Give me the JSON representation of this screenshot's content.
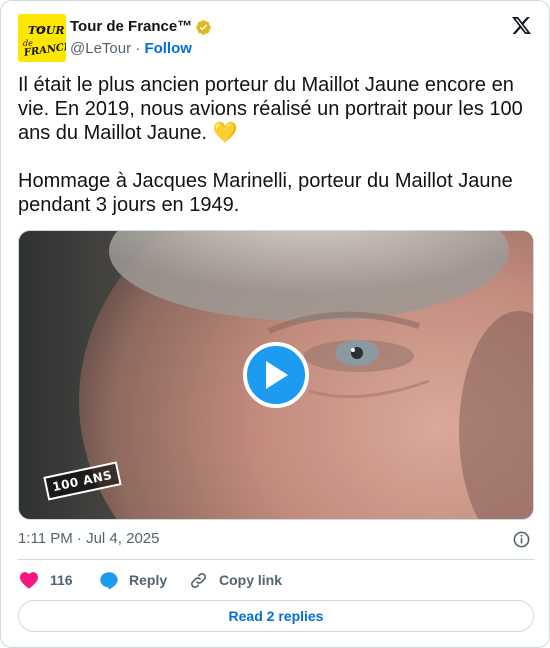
{
  "author": {
    "name": "Tour de France™",
    "handle": "@LeTour",
    "separator": "·",
    "follow_label": "Follow",
    "avatar_logo_text": "TOUR de FRANCE"
  },
  "tweet": {
    "text": "Il était le plus ancien porteur du Maillot Jaune encore en vie. En 2019, nous avions réalisé un portrait pour les 100 ans du Maillot Jaune. 💛\n\nHommage à Jacques Marinelli, porteur du Maillot Jaune pendant 3 jours en 1949."
  },
  "media": {
    "type": "video",
    "badge_text": "100 ANS",
    "play_icon": "play-icon"
  },
  "meta": {
    "time": "1:11 PM",
    "separator": "·",
    "date": "Jul 4, 2025"
  },
  "actions": {
    "like_count": "116",
    "reply_label": "Reply",
    "copy_label": "Copy link"
  },
  "read_replies_label": "Read 2 replies",
  "colors": {
    "brand_yellow": "#ffe600",
    "link_blue": "#006fd6",
    "play_blue": "#1d9bf0",
    "like_pink": "#f91880",
    "verified_gold": "#e2b719"
  }
}
